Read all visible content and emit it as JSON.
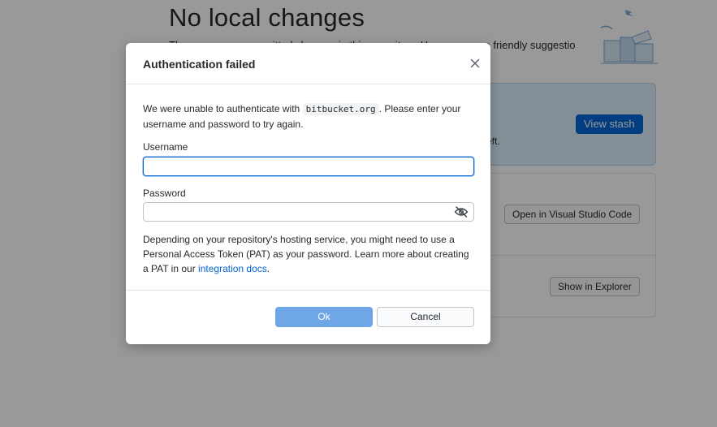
{
  "background": {
    "title": "No local changes",
    "description": "There are no uncommitted changes in this repository. Here are some friendly suggestions for",
    "stash_card": {
      "text_tail": "eft.",
      "button_label": "View stash"
    },
    "actions": [
      {
        "button_label": "Open in Visual Studio Code"
      },
      {
        "button_label": "Show in Explorer"
      }
    ]
  },
  "dialog": {
    "title": "Authentication failed",
    "intro_before": "We were unable to authenticate with ",
    "host": "bitbucket.org",
    "intro_after": ". Please enter your username and password to try again.",
    "username": {
      "label": "Username",
      "value": "",
      "placeholder": ""
    },
    "password": {
      "label": "Password",
      "value": "",
      "placeholder": ""
    },
    "help_before": "Depending on your repository's hosting service, you might need to use a Personal Access Token (PAT) as your password. Learn more about creating a PAT in our ",
    "help_link": "integration docs",
    "help_after": ".",
    "ok_label": "Ok",
    "cancel_label": "Cancel"
  },
  "colors": {
    "accent": "#0366d6",
    "ok_disabled": "#6ea6e6",
    "overlay": "#000000"
  },
  "icons": {
    "close": "close-icon",
    "password_visibility": "eye-slash-icon",
    "illustration": "empty-state-illustration"
  }
}
